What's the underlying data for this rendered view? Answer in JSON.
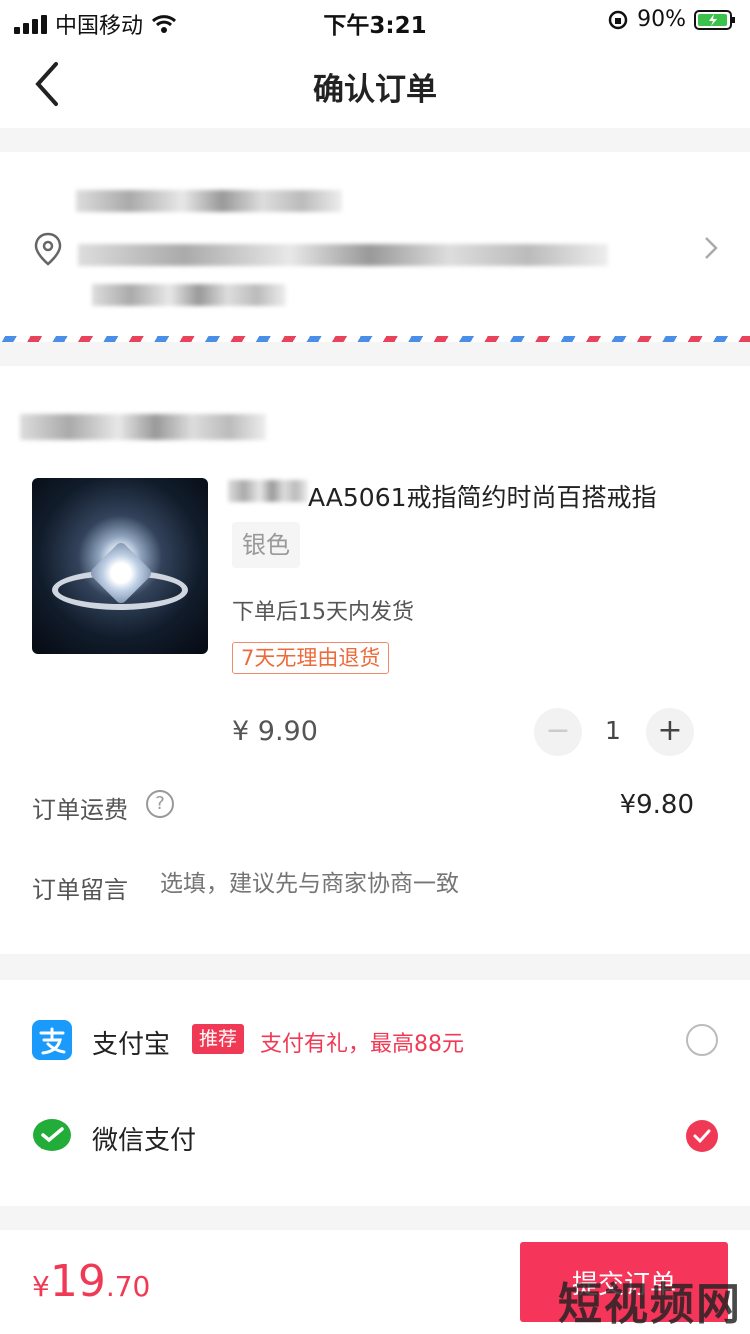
{
  "status": {
    "carrier": "中国移动",
    "time": "下午3:21",
    "battery": "90%"
  },
  "nav": {
    "title": "确认订单"
  },
  "product": {
    "title": "AA5061戒指简约时尚百搭戒指",
    "sku": "银色",
    "shipping": "下单后15天内发货",
    "return_tag": "7天无理由退货",
    "price": "¥ 9.90",
    "quantity": "1",
    "minus": "−",
    "plus": "+"
  },
  "order": {
    "freight_label": "订单运费",
    "freight_help": "?",
    "freight_value": "¥9.80",
    "note_label": "订单留言",
    "note_placeholder": "选填，建议先与商家协商一致"
  },
  "payment": {
    "alipay": {
      "name": "支付宝",
      "badge": "推荐",
      "promo": "支付有礼，最高88元",
      "selected": false
    },
    "wechat": {
      "name": "微信支付",
      "selected": true
    }
  },
  "footer": {
    "currency": "¥",
    "total_int": "19",
    "total_dec": ".70",
    "submit": "提交订单",
    "watermark": "短视频网"
  },
  "colors": {
    "accent": "#f03a55",
    "tag": "#ee6a3a"
  }
}
